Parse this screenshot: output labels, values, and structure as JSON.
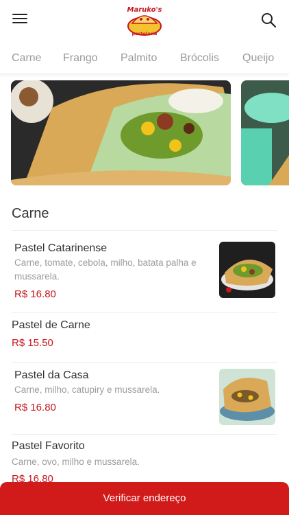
{
  "header": {
    "menu_icon": "hamburger-menu-icon",
    "logo_text_top": "Maruko's",
    "logo_text_bottom": "pastelaria",
    "search_icon": "search-icon"
  },
  "tabs": [
    {
      "label": "Carne"
    },
    {
      "label": "Frango"
    },
    {
      "label": "Palmito"
    },
    {
      "label": "Brócolis"
    },
    {
      "label": "Queijo"
    }
  ],
  "section": {
    "title": "Carne"
  },
  "items": [
    {
      "name": "Pastel Catarinense",
      "description": "Carne, tomate, cebola, milho, batata palha e mussarela.",
      "price": "R$ 16.80"
    },
    {
      "name": "Pastel de Carne",
      "description": "",
      "price": "R$ 15.50"
    },
    {
      "name": "Pastel da Casa",
      "description": "Carne, milho, catupiry e mussarela.",
      "price": "R$ 16.80"
    },
    {
      "name": "Pastel Favorito",
      "description": "Carne, ovo, milho e mussarela.",
      "price": "R$ 16.80"
    }
  ],
  "cta": {
    "label": "Verificar endereço"
  },
  "colors": {
    "accent": "#d11a1a",
    "price": "#c8161d"
  }
}
